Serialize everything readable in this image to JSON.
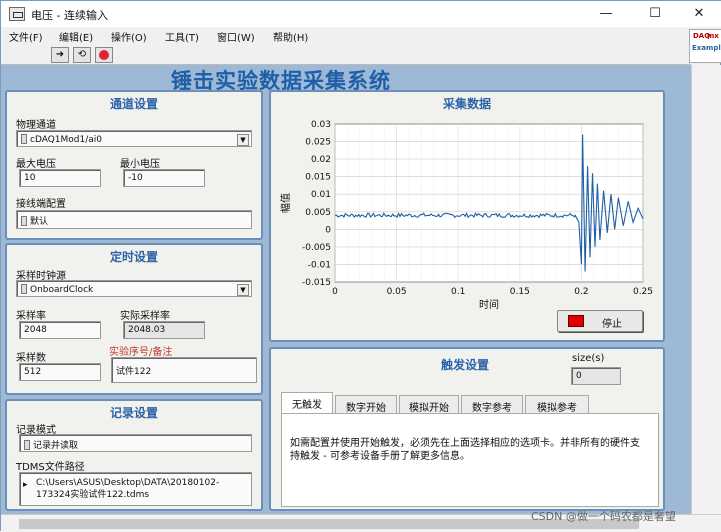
{
  "window": {
    "title": "电压 - 连续输入",
    "controls": {
      "minimize": "—",
      "maximize": "☐",
      "close": "✕"
    }
  },
  "menu": [
    "文件(F)",
    "编辑(E)",
    "操作(O)",
    "工具(T)",
    "窗口(W)",
    "帮助(H)"
  ],
  "toolbar": {
    "run": "➜",
    "run_continuous": "⟲",
    "abort": "abort"
  },
  "logo": {
    "top": "DAQ",
    "mid": "mx",
    "bottom": "Example"
  },
  "app_title": "锤击实验数据采集系统",
  "channel": {
    "title": "通道设置",
    "physical_label": "物理通道",
    "physical_value": "cDAQ1Mod1/ai0",
    "max_label": "最大电压",
    "max_value": "10",
    "min_label": "最小电压",
    "min_value": "-10",
    "terminal_label": "接线端配置",
    "terminal_value": "默认"
  },
  "timing": {
    "title": "定时设置",
    "clock_label": "采样时钟源",
    "clock_value": "OnboardClock",
    "rate_label": "采样率",
    "rate_value": "2048",
    "actual_rate_label": "实际采样率",
    "actual_rate_value": "2048.03",
    "samples_label": "采样数",
    "samples_value": "512",
    "note_label": "实验序号/备注",
    "note_value": "试件122"
  },
  "logging": {
    "title": "记录设置",
    "mode_label": "记录模式",
    "mode_value": "记录并读取",
    "path_label": "TDMS文件路径",
    "path_line1": "C:\\Users\\ASUS\\Desktop\\DATA\\20180102-",
    "path_line2": "173324实验试件122.tdms"
  },
  "acquire": {
    "title": "采集数据",
    "stop_label": "停止",
    "stop_color": "#e00000"
  },
  "trigger": {
    "title": "触发设置",
    "size_label": "size(s)",
    "size_value": "0",
    "tabs": [
      "无触发",
      "数字开始",
      "模拟开始",
      "数字参考",
      "模拟参考"
    ],
    "active_tab": 0,
    "message": "如需配置并使用开始触发，必须先在上面选择相应的选项卡。并非所有的硬件支持触发 - 可参考设备手册了解更多信息。"
  },
  "watermark": "CSDN @做一个码农都是奢望",
  "chart_data": {
    "type": "line",
    "title": "",
    "xlabel": "时间",
    "ylabel": "幅值",
    "xlim": [
      0,
      0.25
    ],
    "ylim": [
      -0.015,
      0.03
    ],
    "x_ticks": [
      "0",
      "0.05",
      "0.1",
      "0.15",
      "0.2",
      "0.25"
    ],
    "y_ticks": [
      "0.03",
      "0.025",
      "0.02",
      "0.015",
      "0.01",
      "0.005",
      "0",
      "-0.005",
      "-0.01",
      "-0.015"
    ],
    "grid": true,
    "line_color": "#1f5fa8",
    "series": [
      {
        "x": [
          0,
          0.02,
          0.05,
          0.1,
          0.15,
          0.195,
          0.198,
          0.2,
          0.201,
          0.203,
          0.205,
          0.207,
          0.209,
          0.211,
          0.213,
          0.215,
          0.218,
          0.221,
          0.224,
          0.227,
          0.23,
          0.234,
          0.238,
          0.242,
          0.246,
          0.25
        ],
        "y": [
          0.004,
          0.004,
          0.004,
          0.004,
          0.004,
          0.004,
          0.002,
          -0.01,
          0.027,
          -0.012,
          0.018,
          -0.008,
          0.016,
          -0.005,
          0.013,
          -0.003,
          0.011,
          -0.001,
          0.01,
          0.0,
          0.009,
          0.001,
          0.008,
          0.002,
          0.006,
          0.003
        ]
      }
    ]
  }
}
